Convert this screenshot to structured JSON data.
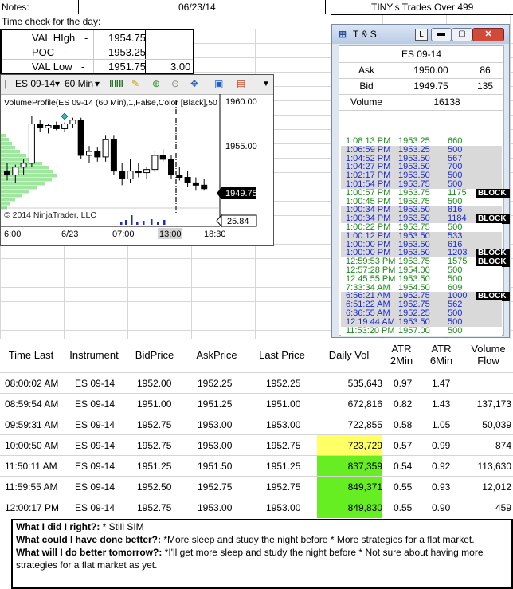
{
  "header": {
    "notes_label": "Notes:",
    "date": "06/23/14",
    "title": "TINY's Trades Over 499",
    "time_check": "Time check for the day:"
  },
  "val_box": [
    {
      "label": "VAL HIgh",
      "dash": "-",
      "value": "1954.75",
      "extra": ""
    },
    {
      "label": "POC",
      "dash": "-",
      "value": "1953.25",
      "extra": ""
    },
    {
      "label": "VAL Low",
      "dash": "-",
      "value": "1951.75",
      "extra": "3.00"
    }
  ],
  "chart_window": {
    "instrument": "ES 09-14",
    "interval": "60 Min",
    "indicator_label": "VolumeProfile(ES 09-14 (60 Min),1,False,Color [Black],50",
    "copyright": "© 2014 NinjaTrader, LLC",
    "price_labels": [
      "1960.00",
      "1955.00"
    ],
    "last_price_badge": "1949.75",
    "volume_badge": "25.84",
    "time_labels": [
      "6:00",
      "6/23",
      "07:00",
      "13:00",
      "18:30"
    ],
    "accent_color": "#000000",
    "profile_color": "#8fe08f"
  },
  "chart_data": {
    "type": "line",
    "title": "",
    "candles": [
      {
        "o": 1952.0,
        "h": 1953.0,
        "l": 1950.8,
        "c": 1951.5
      },
      {
        "o": 1951.5,
        "h": 1952.8,
        "l": 1950.5,
        "c": 1952.5
      },
      {
        "o": 1952.5,
        "h": 1953.5,
        "l": 1951.5,
        "c": 1953.0
      },
      {
        "o": 1953.0,
        "h": 1959.0,
        "l": 1952.5,
        "c": 1958.0
      },
      {
        "o": 1958.0,
        "h": 1958.5,
        "l": 1957.0,
        "c": 1957.5
      },
      {
        "o": 1957.5,
        "h": 1958.0,
        "l": 1956.8,
        "c": 1957.8
      },
      {
        "o": 1957.8,
        "h": 1958.3,
        "l": 1957.2,
        "c": 1957.4
      },
      {
        "o": 1957.4,
        "h": 1958.2,
        "l": 1957.0,
        "c": 1958.0
      },
      {
        "o": 1958.0,
        "h": 1958.8,
        "l": 1957.5,
        "c": 1958.5
      },
      {
        "o": 1958.5,
        "h": 1958.8,
        "l": 1953.5,
        "c": 1954.0
      },
      {
        "o": 1954.0,
        "h": 1955.2,
        "l": 1953.0,
        "c": 1954.5
      },
      {
        "o": 1954.5,
        "h": 1955.0,
        "l": 1953.2,
        "c": 1953.8
      },
      {
        "o": 1953.8,
        "h": 1956.5,
        "l": 1953.2,
        "c": 1956.0
      },
      {
        "o": 1956.0,
        "h": 1956.5,
        "l": 1951.5,
        "c": 1952.0
      },
      {
        "o": 1952.0,
        "h": 1953.0,
        "l": 1950.2,
        "c": 1951.0
      },
      {
        "o": 1951.0,
        "h": 1953.5,
        "l": 1950.5,
        "c": 1952.0
      },
      {
        "o": 1952.0,
        "h": 1953.0,
        "l": 1951.2,
        "c": 1951.8
      },
      {
        "o": 1951.8,
        "h": 1952.5,
        "l": 1951.0,
        "c": 1952.2
      },
      {
        "o": 1952.2,
        "h": 1954.5,
        "l": 1951.8,
        "c": 1954.0
      },
      {
        "o": 1954.0,
        "h": 1954.8,
        "l": 1953.2,
        "c": 1953.5
      },
      {
        "o": 1953.5,
        "h": 1954.0,
        "l": 1951.0,
        "c": 1951.5
      },
      {
        "o": 1951.5,
        "h": 1952.5,
        "l": 1950.8,
        "c": 1951.2
      },
      {
        "o": 1951.2,
        "h": 1952.0,
        "l": 1950.0,
        "c": 1950.5
      },
      {
        "o": 1950.5,
        "h": 1951.2,
        "l": 1949.5,
        "c": 1950.2
      },
      {
        "o": 1950.2,
        "h": 1951.0,
        "l": 1949.5,
        "c": 1949.75
      }
    ],
    "ylim": [
      1948.0,
      1961.0
    ]
  },
  "ts_window": {
    "title": "T & S",
    "l_button": "L",
    "instrument": "ES 09-14",
    "ask_label": "Ask",
    "ask_price": "1950.00",
    "ask_size": "86",
    "bid_label": "Bid",
    "bid_price": "1949.75",
    "bid_size": "135",
    "volume_label": "Volume",
    "volume": "16138",
    "rows": [
      {
        "time": "1:08:13 PM",
        "price": "1953.25",
        "size": "660",
        "color": "#1a8a1a",
        "bg": "#ffffff",
        "block": ""
      },
      {
        "time": "1:06:59 PM",
        "price": "1953.25",
        "size": "500",
        "color": "#1a2ad0",
        "bg": "#d9d9d9",
        "block": ""
      },
      {
        "time": "1:04:52 PM",
        "price": "1953.50",
        "size": "567",
        "color": "#1a2ad0",
        "bg": "#d9d9d9",
        "block": ""
      },
      {
        "time": "1:04:27 PM",
        "price": "1953.50",
        "size": "700",
        "color": "#1a2ad0",
        "bg": "#d9d9d9",
        "block": ""
      },
      {
        "time": "1:02:17 PM",
        "price": "1953.50",
        "size": "500",
        "color": "#1a2ad0",
        "bg": "#d9d9d9",
        "block": ""
      },
      {
        "time": "1:01:54 PM",
        "price": "1953.75",
        "size": "500",
        "color": "#1a2ad0",
        "bg": "#d9d9d9",
        "block": ""
      },
      {
        "time": "1:00:57 PM",
        "price": "1953.75",
        "size": "1175",
        "color": "#1a8a1a",
        "bg": "#ffffff",
        "block": "BLOCK"
      },
      {
        "time": "1:00:45 PM",
        "price": "1953.75",
        "size": "500",
        "color": "#1a8a1a",
        "bg": "#ffffff",
        "block": ""
      },
      {
        "time": "1:00:34 PM",
        "price": "1953.50",
        "size": "816",
        "color": "#1a2ad0",
        "bg": "#d9d9d9",
        "block": ""
      },
      {
        "time": "1:00:34 PM",
        "price": "1953.50",
        "size": "1184",
        "color": "#1a2ad0",
        "bg": "#d9d9d9",
        "block": "BLOCK"
      },
      {
        "time": "1:00:22 PM",
        "price": "1953.75",
        "size": "500",
        "color": "#1a8a1a",
        "bg": "#ffffff",
        "block": ""
      },
      {
        "time": "1:00:12 PM",
        "price": "1953.50",
        "size": "533",
        "color": "#1a2ad0",
        "bg": "#d9d9d9",
        "block": ""
      },
      {
        "time": "1:00:00 PM",
        "price": "1953.50",
        "size": "616",
        "color": "#1a2ad0",
        "bg": "#d9d9d9",
        "block": ""
      },
      {
        "time": "1:00:00 PM",
        "price": "1953.50",
        "size": "1203",
        "color": "#1a2ad0",
        "bg": "#d9d9d9",
        "block": "BLOCK"
      },
      {
        "time": "12:59:53 PM",
        "price": "1953.75",
        "size": "1575",
        "color": "#1a8a1a",
        "bg": "#ffffff",
        "block": "BLOCK"
      },
      {
        "time": "12:57:28 PM",
        "price": "1954.00",
        "size": "500",
        "color": "#1a8a1a",
        "bg": "#ffffff",
        "block": ""
      },
      {
        "time": "12:45:55 PM",
        "price": "1953.50",
        "size": "500",
        "color": "#1a8a1a",
        "bg": "#ffffff",
        "block": ""
      },
      {
        "time": "7:33:34 AM",
        "price": "1954.50",
        "size": "609",
        "color": "#1a8a1a",
        "bg": "#ffffff",
        "block": ""
      },
      {
        "time": "6:56:21 AM",
        "price": "1952.75",
        "size": "1000",
        "color": "#1a2ad0",
        "bg": "#d9d9d9",
        "block": "BLOCK"
      },
      {
        "time": "6:51:22 AM",
        "price": "1952.75",
        "size": "562",
        "color": "#1a2ad0",
        "bg": "#d9d9d9",
        "block": ""
      },
      {
        "time": "6:36:55 AM",
        "price": "1952.25",
        "size": "500",
        "color": "#1a2ad0",
        "bg": "#d9d9d9",
        "block": ""
      },
      {
        "time": "12:19:44 AM",
        "price": "1953.50",
        "size": "500",
        "color": "#1a2ad0",
        "bg": "#d9d9d9",
        "block": ""
      },
      {
        "time": "11:53:20 PM",
        "price": "1957.00",
        "size": "500",
        "color": "#1a8a1a",
        "bg": "#ffffff",
        "block": ""
      }
    ]
  },
  "table": {
    "headers": [
      "Time Last",
      "Instrument",
      "BidPrice",
      "AskPrice",
      "Last Price",
      "Daily Vol",
      "ATR 2Min",
      "ATR 6Min",
      "Volume Flow"
    ],
    "rows": [
      {
        "time": "08:00:02 AM",
        "inst": "ES 09-14",
        "bid": "1952.00",
        "ask": "1952.25",
        "last": "1952.25",
        "vol": "535,643",
        "atr2": "0.97",
        "atr6": "1.47",
        "flow": "",
        "vol_bg": "#ffffff"
      },
      {
        "time": "08:59:54 AM",
        "inst": "ES 09-14",
        "bid": "1951.00",
        "ask": "1951.25",
        "last": "1951.00",
        "vol": "672,816",
        "atr2": "0.82",
        "atr6": "1.43",
        "flow": "137,173",
        "vol_bg": "#ffffff"
      },
      {
        "time": "09:59:31 AM",
        "inst": "ES 09-14",
        "bid": "1952.75",
        "ask": "1953.00",
        "last": "1953.00",
        "vol": "722,855",
        "atr2": "0.58",
        "atr6": "1.05",
        "flow": "50,039",
        "vol_bg": "#ffffff"
      },
      {
        "time": "10:00:50 AM",
        "inst": "ES 09-14",
        "bid": "1952.75",
        "ask": "1953.00",
        "last": "1952.75",
        "vol": "723,729",
        "atr2": "0.57",
        "atr6": "0.99",
        "flow": "874",
        "vol_bg": "#ffff66"
      },
      {
        "time": "11:50:11 AM",
        "inst": "ES 09-14",
        "bid": "1951.25",
        "ask": "1951.50",
        "last": "1951.25",
        "vol": "837,359",
        "atr2": "0.54",
        "atr6": "0.92",
        "flow": "113,630",
        "vol_bg": "#66ee22"
      },
      {
        "time": "11:59:55 AM",
        "inst": "ES 09-14",
        "bid": "1952.50",
        "ask": "1952.75",
        "last": "1952.75",
        "vol": "849,371",
        "atr2": "0.55",
        "atr6": "0.93",
        "flow": "12,012",
        "vol_bg": "#66ee22"
      },
      {
        "time": "12:00:17 PM",
        "inst": "ES 09-14",
        "bid": "1952.75",
        "ask": "1953.00",
        "last": "1953.00",
        "vol": "849,830",
        "atr2": "0.55",
        "atr6": "0.90",
        "flow": "459",
        "vol_bg": "#66ee22"
      }
    ]
  },
  "notes": {
    "q1_label": "What I did I right?:",
    "q1_text": " * Still SIM",
    "q2_label": "What could I have done better?:",
    "q2_text": "  *More sleep and study the night before * More strategies for a flat market.",
    "q3_label": "What will I do better tomorrow?:",
    "q3_text": "   *I'll get more sleep and study the night before * Not sure about having more strategies for a flat market as yet."
  }
}
